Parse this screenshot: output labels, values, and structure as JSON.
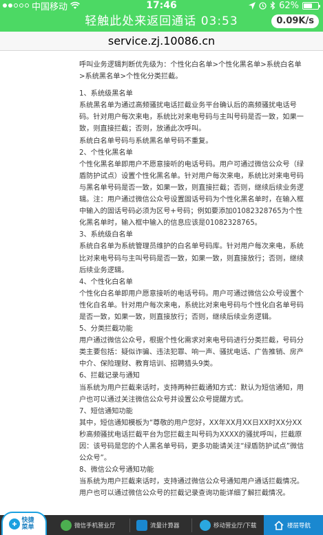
{
  "status_bar": {
    "carrier": "中国移动",
    "time": "17:46",
    "battery_percent": "62%",
    "battery_level": 0.62
  },
  "call_banner": {
    "text": "轻触此处来返回通话 03:53",
    "speed": "0.09K/s"
  },
  "url_bar": {
    "url": "service.zj.10086.cn"
  },
  "content": {
    "paragraphs": [
      "呼叫业务逻辑判断优先级为：个性化白名单>个性化黑名单>系统白名单>系统黑名单>个性化分类拦截。",
      "",
      "1、系统级黑名单",
      "系统黑名单为通过高频骚扰电话拦截业务平台确认后的高频骚扰电话号码。针对用户每次来电，系统比对来电号码与主叫号码是否一致，如果一致，则直接拦截；否则，放通此次呼叫。",
      "系统白名单号码与系统黑名单号码不重复。",
      "2、个性化黑名单",
      "个性化黑名单即用户不愿意接听的电话号码。用户可通过微信公众号（绿盾防护试点）设置个性化黑名单。针对用户每次来电，系统比对来电号码与黑名单号码是否一致，如果一致，则直接拦截；否则，继续后续业务逻辑。注：用户通过微信公众号设置固话号码为个性化黑名单时，在输入框中输入的固话号码必须为区号+号码；例如要添加01082328765为个性化黑名单时，输入框中输入的信息应该是01082328765。",
      "3、系统级白名单",
      "系统白名单为系统管理员维护的白名单号码库。针对用户每次来电，系统比对来电号码与主叫号码是否一致，如果一致，则直接放行；否则，继续后续业务逻辑。",
      "4、个性化白名单",
      "个性化白名单即用户愿意接听的电话号码。用户可通过微信公众号设置个性化白名单。针对用户每次来电，系统比对来电号码与个性化白名单号码是否一致，如果一致，则直接放行；否则，继续后续业务逻辑。",
      "5、分类拦截功能",
      "用户通过微信公众号，根据个性化需求对来电号码进行分类拦截，号码分类主要包括：疑似诈骗、违法犯罪、响一声、骚扰电话、广告推销、房产中介、保险理财、教育培训、招聘猎头9类。",
      "6、拦截记录与通知",
      "当系统为用户拦截来话时，支持两种拦截通知方式：默认为短信通知，用户也可以通过关注微信公众号并设置公众号提醒方式。",
      "7、短信通知功能",
      "其中，短信通知模板为“尊敬的用户您好，XX年XX月XX日XX时XX分XX秒高频骚扰电话拦截平台为您拦截主叫号码为XXXX的骚扰呼叫，拦截原因：该号码是您的个人黑名单号码，更多功能请关注“绿盾防护试点”微信公众号”。",
      "8、微信公众号通知功能",
      "当系统为用户拦截来话时，支持通过微信公众号通知用户通话拦截情况。用户也可以通过微信公众号的拦截记录查询功能详细了解拦截情况。"
    ]
  },
  "bottom_nav": {
    "quick_menu": "快捷菜单",
    "items": [
      {
        "label": "微信手机营业厅",
        "icon": "wechat-icon",
        "color": "#4caf50"
      },
      {
        "label": "流量计算器",
        "icon": "calculator-icon",
        "color": "#1a88d0"
      },
      {
        "label": "移动营业厅/下载",
        "icon": "china-mobile-icon",
        "color": "#2aa8e0"
      },
      {
        "label": "楼层导航",
        "icon": "home-icon",
        "color": "#ffffff"
      }
    ]
  }
}
